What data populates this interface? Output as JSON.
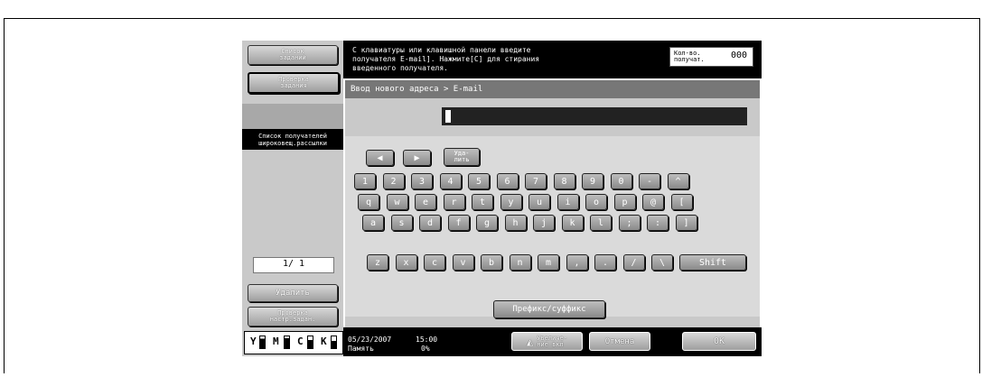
{
  "left": {
    "job_list": "Список\nзаданий",
    "check_job": "Проверка\nзадания",
    "broadcast": "Список получателей\nшироковещ.рассылки",
    "page": "1/ 1",
    "delete": "Удалить",
    "check_settings": "Проверка\nнастр.задан.",
    "toner": [
      "Y",
      "M",
      "C",
      "K"
    ]
  },
  "header": {
    "message": "С клавиатуры или клавишной панели введите\nполучателя E-mail]. Нажмите[C] для стирания\nвведенного получателя.",
    "counter_label": "Кол-во.\nполучат.",
    "counter_value": "000"
  },
  "breadcrumb": "Ввод нового адреса > E-mail",
  "keyboard": {
    "arrow_left": "◀",
    "arrow_right": "▶",
    "delete": "Уда-\nлить",
    "row1": [
      "1",
      "2",
      "3",
      "4",
      "5",
      "6",
      "7",
      "8",
      "9",
      "0",
      "-",
      "^"
    ],
    "row2": [
      "q",
      "w",
      "e",
      "r",
      "t",
      "y",
      "u",
      "i",
      "o",
      "p",
      "@",
      "["
    ],
    "row3": [
      "a",
      "s",
      "d",
      "f",
      "g",
      "h",
      "j",
      "k",
      "l",
      ";",
      ":",
      "]"
    ],
    "row4": [
      "z",
      "x",
      "c",
      "v",
      "b",
      "n",
      "m",
      ",",
      ".",
      "/",
      "\\"
    ],
    "shift": "Shift"
  },
  "prefix_suffix": "Префикс/суффикс",
  "footer": {
    "date": "05/23/2007",
    "time": "15:00",
    "memory_label": "Память",
    "memory_value": "0%",
    "zoom": "Увеличе-\nние вкл",
    "cancel": "Отмена",
    "ok": "OK"
  }
}
